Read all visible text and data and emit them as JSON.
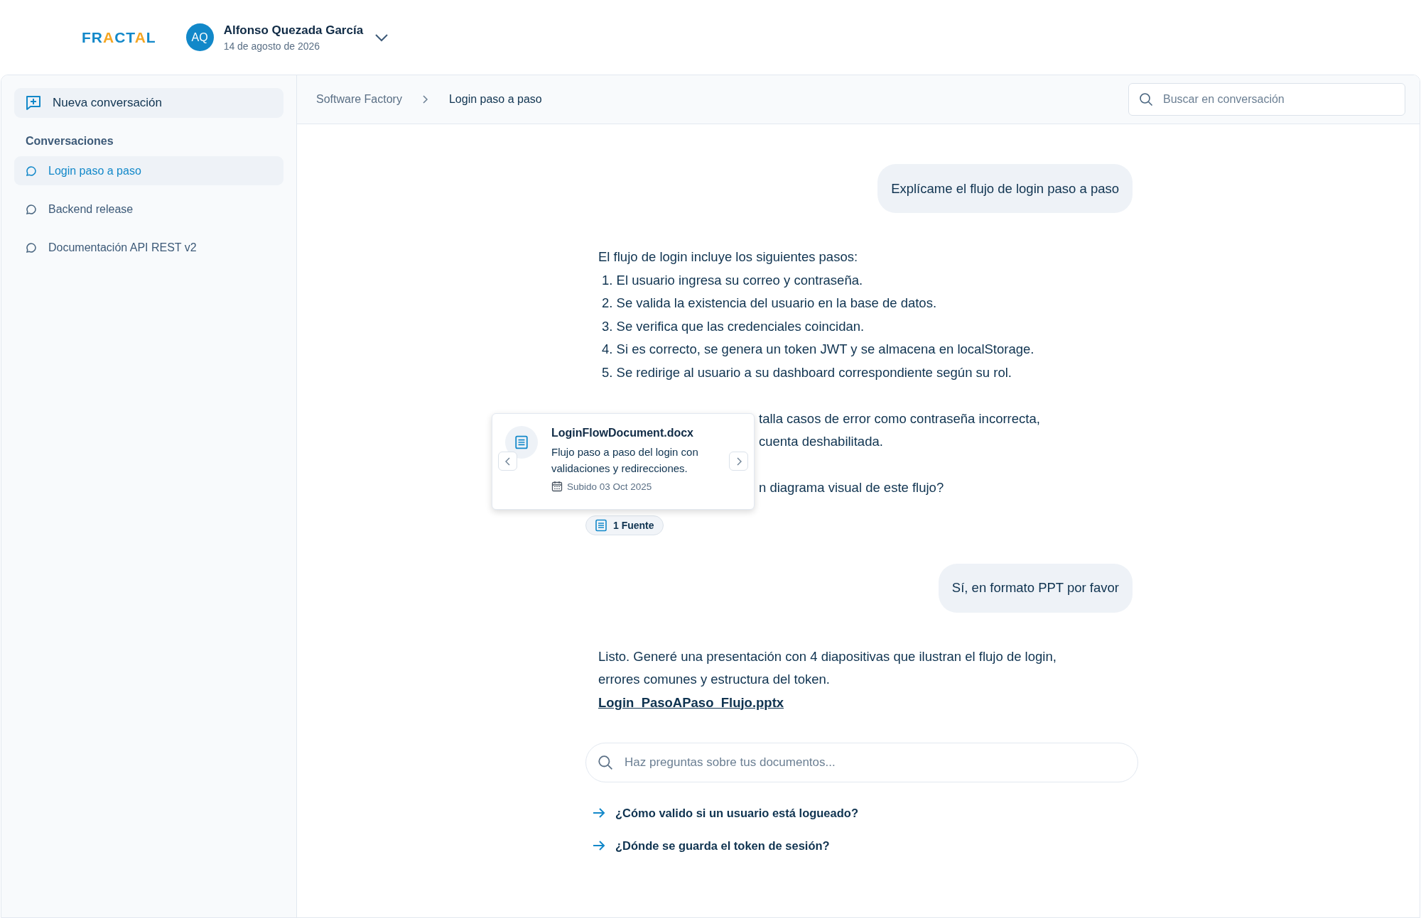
{
  "header": {
    "logo": "FRACTAL",
    "user": {
      "initials": "AQ",
      "name": "Alfonso Quezada García",
      "date": "14 de agosto de 2026"
    }
  },
  "sidebar": {
    "new_button": "Nueva conversación",
    "section_title": "Conversaciones",
    "items": [
      {
        "label": "Login paso a paso",
        "selected": true
      },
      {
        "label": "Backend release",
        "selected": false
      },
      {
        "label": "Documentación API REST v2",
        "selected": false
      }
    ]
  },
  "breadcrumb": [
    "Software Factory",
    "Login paso a paso"
  ],
  "search": {
    "placeholder": "Buscar en conversación"
  },
  "messages": [
    {
      "kind": "user",
      "text": "Explícame el flujo de login paso a paso"
    },
    {
      "kind": "assistant",
      "lines": [
        "El flujo de login incluye los siguientes pasos:",
        "1. El usuario ingresa su correo y contraseña.",
        "2. Se valida la existencia del usuario en la base de datos.",
        "3. Se verifica que las credenciales coincidan.",
        "4. Si es correcto, se genera un token JWT y se almacena en localStorage.",
        "5. Se redirige al usuario a su dashboard correspondiente según su rol."
      ],
      "covered_paragraphs": [
        [
          "talla casos de error como contraseña incorrecta,",
          "cuenta deshabilitada."
        ],
        [
          "n diagrama visual de este flujo?"
        ]
      ],
      "sources_chip": "1 Fuente",
      "popover": {
        "title": "LoginFlowDocument.docx",
        "description": "Flujo paso a paso del login con validaciones y redirecciones.",
        "date": "Subido 03 Oct 2025"
      }
    },
    {
      "kind": "user",
      "text": "Sí, en formato PPT por favor"
    },
    {
      "kind": "assistant",
      "lines": [
        "Listo. Generé una presentación con 4 diapositivas que ilustran el flujo de login, errores comunes y estructura del token."
      ],
      "attachment": "Login_PasoAPaso_Flujo.pptx"
    }
  ],
  "composer": {
    "placeholder": "Haz preguntas sobre tus documentos..."
  },
  "suggestions": [
    "¿Cómo valido si un usuario está logueado?",
    "¿Dónde se guarda el token de sesión?"
  ]
}
